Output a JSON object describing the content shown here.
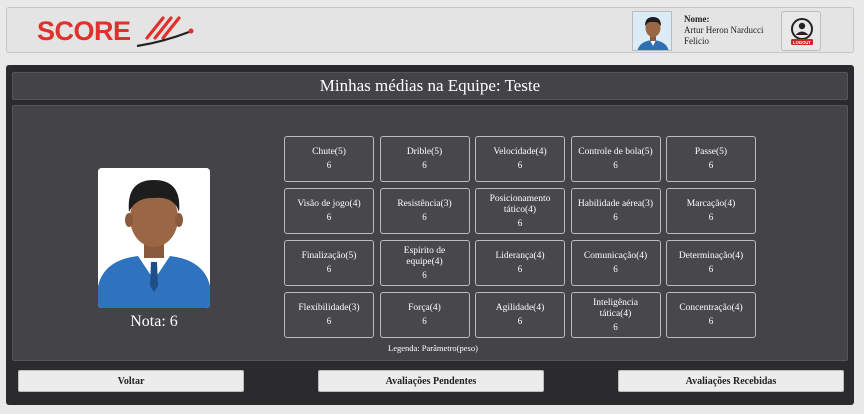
{
  "header": {
    "logo_text": "SCORE",
    "user_label": "Nome:",
    "user_name_line1": "Artur Heron Narducci",
    "user_name_line2": "Felicio",
    "logout_label": "LOGOUT"
  },
  "main": {
    "title": "Minhas médias na Equipe: Teste",
    "nota": "Nota: 6",
    "legend": "Legenda: Parâmetro(peso)",
    "skills": [
      {
        "label": "Chute(5)",
        "value": "6"
      },
      {
        "label": "Drible(5)",
        "value": "6"
      },
      {
        "label": "Velocidade(4)",
        "value": "6"
      },
      {
        "label": "Controle de bola(5)",
        "value": "6"
      },
      {
        "label": "Passe(5)",
        "value": "6"
      },
      {
        "label": "Visão de jogo(4)",
        "value": "6"
      },
      {
        "label": "Resistência(3)",
        "value": "6"
      },
      {
        "label": "Posicionamento tático(4)",
        "value": "6"
      },
      {
        "label": "Habilidade aérea(3)",
        "value": "6"
      },
      {
        "label": "Marcação(4)",
        "value": "6"
      },
      {
        "label": "Finalização(5)",
        "value": "6"
      },
      {
        "label": "Espírito de equipe(4)",
        "value": "6"
      },
      {
        "label": "Liderança(4)",
        "value": "6"
      },
      {
        "label": "Comunicação(4)",
        "value": "6"
      },
      {
        "label": "Determinação(4)",
        "value": "6"
      },
      {
        "label": "Flexibilidade(3)",
        "value": "6"
      },
      {
        "label": "Força(4)",
        "value": "6"
      },
      {
        "label": "Agilidade(4)",
        "value": "6"
      },
      {
        "label": "Inteligência tática(4)",
        "value": "6"
      },
      {
        "label": "Concentração(4)",
        "value": "6"
      }
    ]
  },
  "footer": {
    "voltar": "Voltar",
    "pendentes": "Avaliações Pendentes",
    "recebidas": "Avaliações Recebidas"
  },
  "colors": {
    "brand": "#e0322d",
    "panel_dark": "#2b2b2d",
    "panel": "#444448"
  }
}
